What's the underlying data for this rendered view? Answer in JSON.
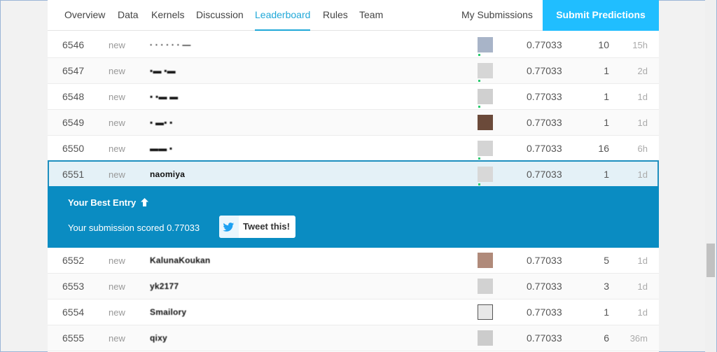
{
  "nav": {
    "tabs": [
      {
        "label": "Overview",
        "active": false
      },
      {
        "label": "Data",
        "active": false
      },
      {
        "label": "Kernels",
        "active": false
      },
      {
        "label": "Discussion",
        "active": false
      },
      {
        "label": "Leaderboard",
        "active": true
      },
      {
        "label": "Rules",
        "active": false
      },
      {
        "label": "Team",
        "active": false
      }
    ],
    "my_submissions": "My Submissions",
    "submit_label": "Submit Predictions"
  },
  "colors": {
    "accent": "#20a8d8",
    "submit_bg": "#20beff",
    "banner_bg": "#0a8cc2",
    "highlight_row": "#e4f1f7"
  },
  "rows_above": [
    {
      "rank": "6546",
      "delta": "new",
      "team": "· · · · · · —",
      "score": "0.77033",
      "entries": "10",
      "last": "15h"
    },
    {
      "rank": "6547",
      "delta": "new",
      "team": "▪▬ ▪▬",
      "score": "0.77033",
      "entries": "1",
      "last": "2d"
    },
    {
      "rank": "6548",
      "delta": "new",
      "team": "▪ ▪▬ ▬",
      "score": "0.77033",
      "entries": "1",
      "last": "1d"
    },
    {
      "rank": "6549",
      "delta": "new",
      "team": "▪ ▬▪ ▪",
      "score": "0.77033",
      "entries": "1",
      "last": "1d"
    },
    {
      "rank": "6550",
      "delta": "new",
      "team": "▬▬ ▪",
      "score": "0.77033",
      "entries": "16",
      "last": "6h"
    }
  ],
  "my_row": {
    "rank": "6551",
    "delta": "new",
    "team": "naomiya",
    "score": "0.77033",
    "entries": "1",
    "last": "1d"
  },
  "banner": {
    "best_entry": "Your Best Entry",
    "arrow_icon": "arrow-up-icon",
    "scored": "Your submission scored 0.77033",
    "tweet": "Tweet this!",
    "tweet_icon": "twitter-bird-icon"
  },
  "rows_below": [
    {
      "rank": "6552",
      "delta": "new",
      "team": "KalunaKoukan",
      "score": "0.77033",
      "entries": "5",
      "last": "1d"
    },
    {
      "rank": "6553",
      "delta": "new",
      "team": "yk2177",
      "score": "0.77033",
      "entries": "3",
      "last": "1d"
    },
    {
      "rank": "6554",
      "delta": "new",
      "team": "Smailory",
      "score": "0.77033",
      "entries": "1",
      "last": "1d"
    },
    {
      "rank": "6555",
      "delta": "new",
      "team": "qixy",
      "score": "0.77033",
      "entries": "6",
      "last": "36m"
    }
  ]
}
